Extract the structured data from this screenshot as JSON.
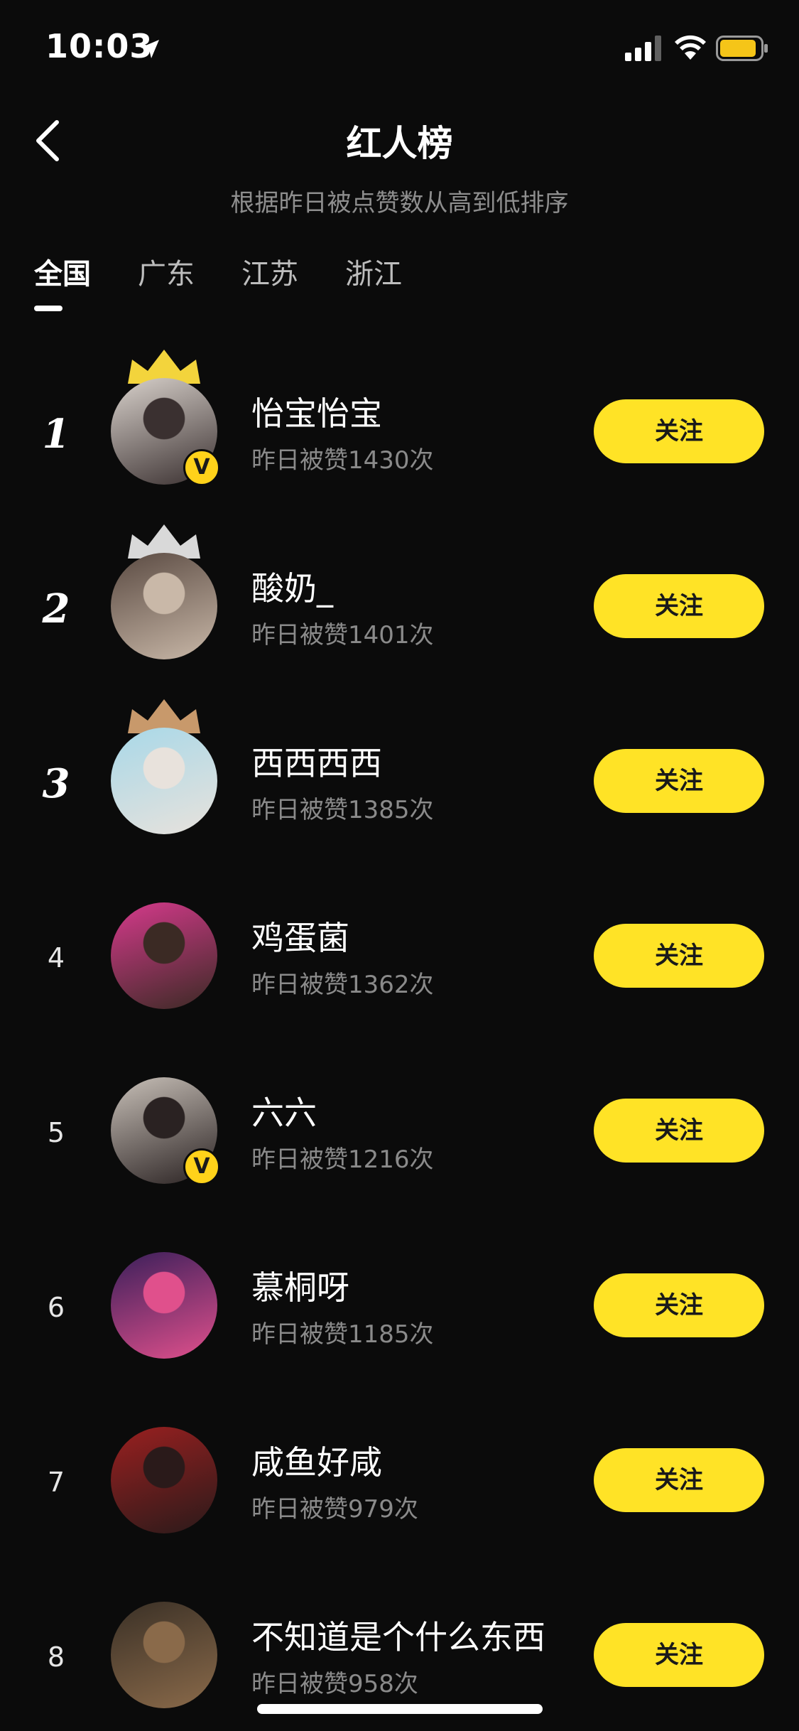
{
  "status_bar": {
    "time": "10:03"
  },
  "header": {
    "title": "红人榜",
    "subtitle": "根据昨日被点赞数从高到低排序"
  },
  "tabs": [
    {
      "label": "全国",
      "active": true
    },
    {
      "label": "广东",
      "active": false
    },
    {
      "label": "江苏",
      "active": false
    },
    {
      "label": "浙江",
      "active": false
    }
  ],
  "ranking": [
    {
      "rank": "1",
      "name": "怡宝怡宝",
      "likes": "昨日被赞1430次",
      "crown": "gold",
      "verified": true,
      "follow_label": "关注"
    },
    {
      "rank": "2",
      "name": "酸奶_",
      "likes": "昨日被赞1401次",
      "crown": "silver",
      "verified": false,
      "follow_label": "关注"
    },
    {
      "rank": "3",
      "name": "西西西西",
      "likes": "昨日被赞1385次",
      "crown": "bronze",
      "verified": false,
      "follow_label": "关注"
    },
    {
      "rank": "4",
      "name": "鸡蛋菌",
      "likes": "昨日被赞1362次",
      "crown": null,
      "verified": false,
      "follow_label": "关注"
    },
    {
      "rank": "5",
      "name": "六六",
      "likes": "昨日被赞1216次",
      "crown": null,
      "verified": true,
      "follow_label": "关注"
    },
    {
      "rank": "6",
      "name": "慕桐呀",
      "likes": "昨日被赞1185次",
      "crown": null,
      "verified": false,
      "follow_label": "关注"
    },
    {
      "rank": "7",
      "name": "咸鱼好咸",
      "likes": "昨日被赞979次",
      "crown": null,
      "verified": false,
      "follow_label": "关注"
    },
    {
      "rank": "8",
      "name": "不知道是个什么东西",
      "likes": "昨日被赞958次",
      "crown": null,
      "verified": false,
      "follow_label": "关注"
    }
  ],
  "badge_text": "V",
  "colors": {
    "background": "#0b0b0b",
    "follow_button": "#ffe326",
    "verified_badge": "#ffd21a",
    "crown_gold": "#f3d43c",
    "crown_silver": "#d9d9d9",
    "crown_bronze": "#c8996b",
    "subtitle": "#8e8e8e"
  }
}
